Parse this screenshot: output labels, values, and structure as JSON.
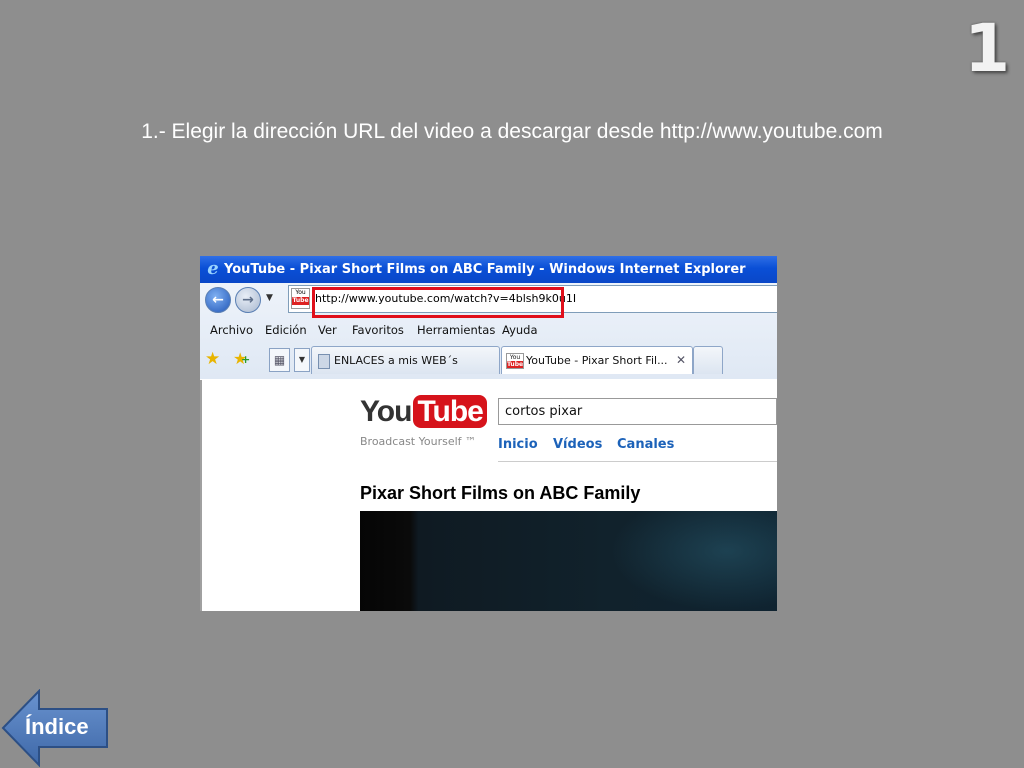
{
  "slide": {
    "number": "1",
    "caption": "1.- Elegir la dirección URL del video a descargar desde http://www.youtube.com",
    "index_button": "Índice"
  },
  "browser": {
    "window_title": "YouTube - Pixar Short Films on ABC Family - Windows Internet Explorer",
    "address_url": "http://www.youtube.com/watch?v=4blsh9k0u1I",
    "menu": [
      "Archivo",
      "Edición",
      "Ver",
      "Favoritos",
      "Herramientas",
      "Ayuda"
    ],
    "tabs": [
      {
        "label": "ENLACES a mis WEB´s"
      },
      {
        "label": "YouTube - Pixar Short Fil...",
        "close": "✕"
      }
    ],
    "favicon_text": {
      "top": "You",
      "bottom": "Tube"
    }
  },
  "youtube": {
    "logo_you": "You",
    "logo_tube": "Tube",
    "slogan": "Broadcast Yourself ™",
    "search_value": "cortos pixar",
    "nav": [
      "Inicio",
      "Vídeos",
      "Canales"
    ],
    "video_title": "Pixar Short Films on ABC Family"
  },
  "colors": {
    "background": "#8e8e8e",
    "titlebar": "#0a4fd6",
    "highlight": "#e0101b",
    "youtube_red": "#d6131b",
    "link_blue": "#1c62b9",
    "index_button": "#4a78b8"
  }
}
